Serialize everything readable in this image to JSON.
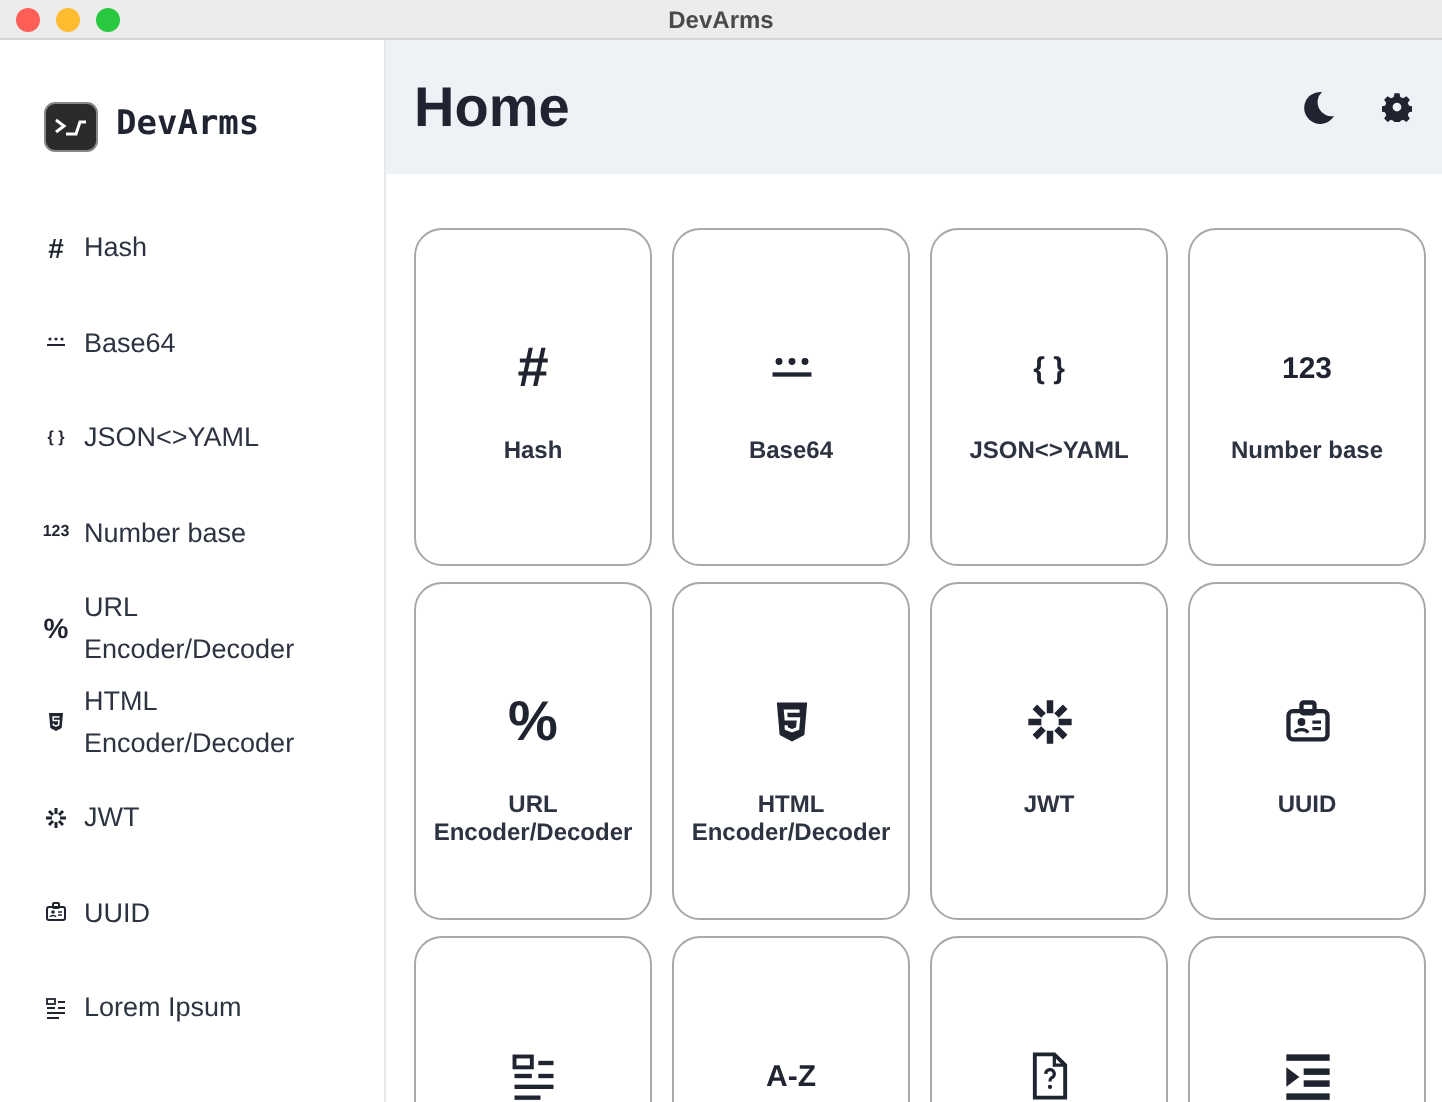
{
  "window": {
    "title": "DevArms"
  },
  "sidebar": {
    "app_name": "DevArms",
    "items": [
      {
        "label": "Hash",
        "icon": {
          "kind": "text",
          "text": "#"
        }
      },
      {
        "label": "Base64",
        "icon": {
          "kind": "stars"
        }
      },
      {
        "label": "JSON<>YAML",
        "icon": {
          "kind": "text",
          "text": "{ }"
        }
      },
      {
        "label": "Number base",
        "icon": {
          "kind": "text",
          "text": "123"
        }
      },
      {
        "label": "URL Encoder/Decoder",
        "icon": {
          "kind": "text",
          "text": "%"
        }
      },
      {
        "label": "HTML Encoder/Decoder",
        "icon": {
          "kind": "html5"
        }
      },
      {
        "label": "JWT",
        "icon": {
          "kind": "burst"
        }
      },
      {
        "label": "UUID",
        "icon": {
          "kind": "badge"
        }
      },
      {
        "label": "Lorem Ipsum",
        "icon": {
          "kind": "lines"
        }
      }
    ]
  },
  "header": {
    "title": "Home"
  },
  "cards": [
    {
      "label": "Hash",
      "icon": {
        "kind": "text",
        "text": "#"
      }
    },
    {
      "label": "Base64",
      "icon": {
        "kind": "stars"
      }
    },
    {
      "label": "JSON<>YAML",
      "icon": {
        "kind": "text",
        "text": "{ }"
      }
    },
    {
      "label": "Number base",
      "icon": {
        "kind": "text",
        "text": "123"
      }
    },
    {
      "label": "URL Encoder/Decoder",
      "icon": {
        "kind": "text",
        "text": "%"
      }
    },
    {
      "label": "HTML Encoder/Decoder",
      "icon": {
        "kind": "html5"
      }
    },
    {
      "label": "JWT",
      "icon": {
        "kind": "burst"
      }
    },
    {
      "label": "UUID",
      "icon": {
        "kind": "badge"
      }
    },
    {
      "icon": {
        "kind": "lines"
      }
    },
    {
      "icon": {
        "kind": "text",
        "text": "A-Z"
      }
    },
    {
      "icon": {
        "kind": "file"
      }
    },
    {
      "icon": {
        "kind": "indent"
      }
    }
  ]
}
